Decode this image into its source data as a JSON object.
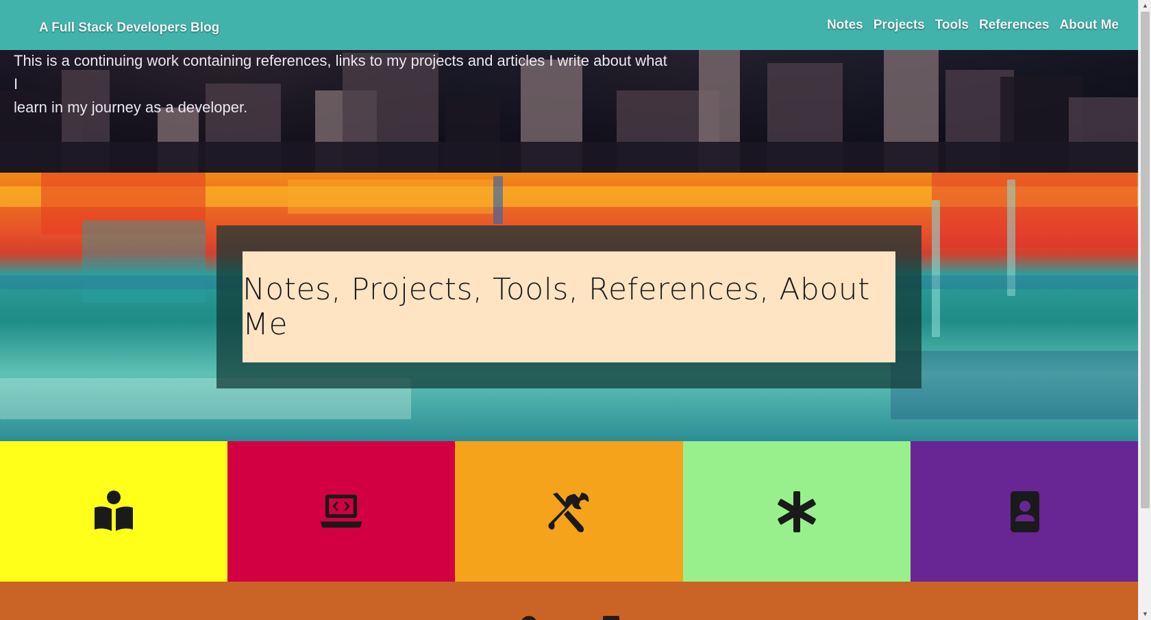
{
  "navbar": {
    "brand": "A Full Stack Developers Blog",
    "links": [
      "Notes",
      "Projects",
      "Tools",
      "References",
      "About Me"
    ],
    "bg_color": "#41b3ab"
  },
  "hero": {
    "intro_line_1": "This is a continuing work containing references, links to my projects and articles I write about what I",
    "intro_line_2": "learn in my journey as a developer."
  },
  "banner": {
    "title": "Notes, Projects, Tools, References, About Me",
    "box_color": "#ffe4c4"
  },
  "tiles": [
    {
      "icon": "book-reader-icon",
      "color": "#ffff1a"
    },
    {
      "icon": "laptop-code-icon",
      "color": "#d20042"
    },
    {
      "icon": "tools-icon",
      "color": "#f5a31b"
    },
    {
      "icon": "asterisk-icon",
      "color": "#98f08d"
    },
    {
      "icon": "address-book-icon",
      "color": "#672694"
    }
  ],
  "footer_strip": {
    "color": "#c96326"
  }
}
